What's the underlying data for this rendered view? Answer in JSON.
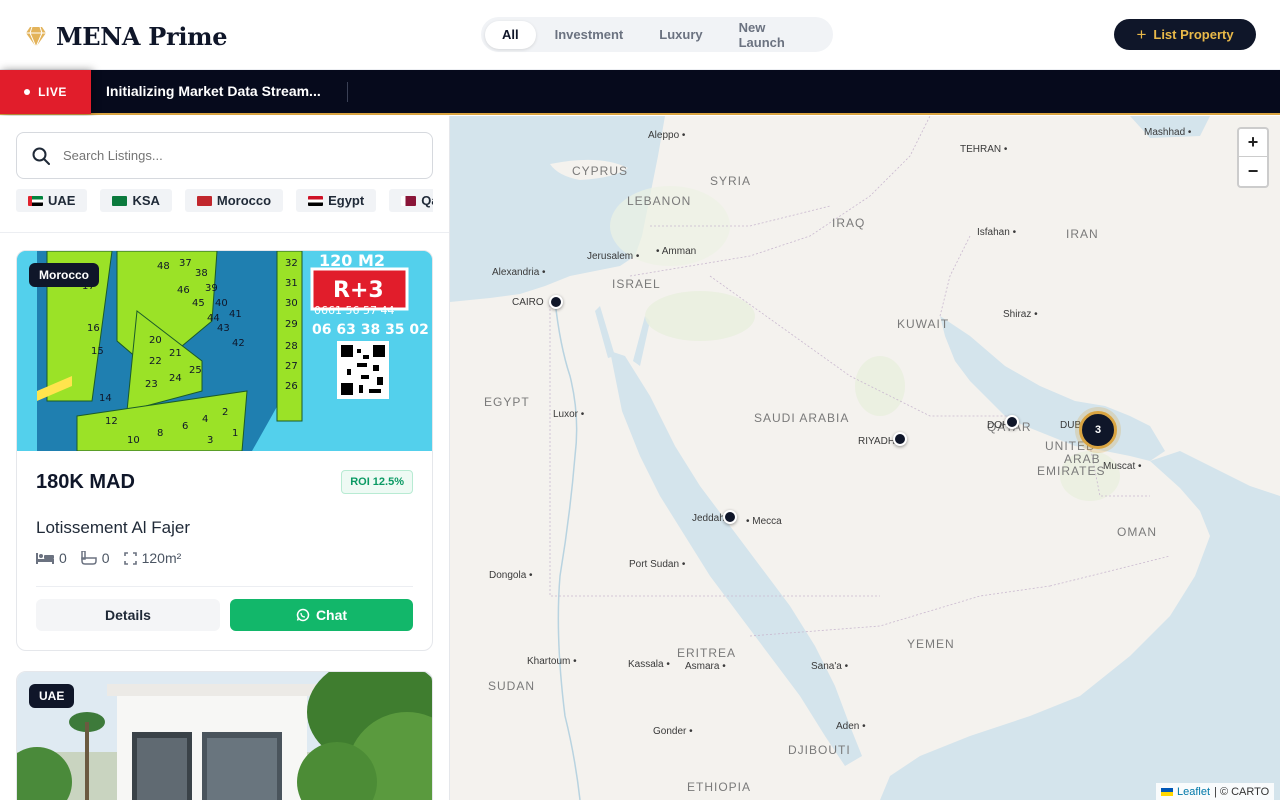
{
  "header": {
    "brand": "MENA Prime",
    "tabs": [
      {
        "label": "All",
        "active": true
      },
      {
        "label": "Investment",
        "active": false
      },
      {
        "label": "Luxury",
        "active": false
      },
      {
        "label": "New Launch",
        "active": false
      }
    ],
    "list_button": "List Property"
  },
  "ticker": {
    "live_label": "LIVE",
    "message": "Initializing Market Data Stream..."
  },
  "sidebar": {
    "search_placeholder": "Search Listings...",
    "countries": [
      "UAE",
      "KSA",
      "Morocco",
      "Egypt",
      "Qatar"
    ],
    "cards": [
      {
        "badge": "Morocco",
        "price": "180K MAD",
        "roi": "ROI 12.5%",
        "title": "Lotissement Al Fajer",
        "beds": "0",
        "baths": "0",
        "area": "120m²",
        "details_label": "Details",
        "chat_label": "Chat",
        "image_text": {
          "size": "120 M2",
          "type": "R+3",
          "phone1": "0661 56 57 44",
          "phone2": "06 63 38 35 02"
        }
      },
      {
        "badge": "UAE"
      }
    ]
  },
  "map": {
    "cities": [
      {
        "name": "Aleppo"
      },
      {
        "name": "Mashhad"
      },
      {
        "name": "TEHRAN"
      },
      {
        "name": "Isfahan"
      },
      {
        "name": "Jerusalem"
      },
      {
        "name": "Amman"
      },
      {
        "name": "Alexandria"
      },
      {
        "name": "CAIRO"
      },
      {
        "name": "Shiraz"
      },
      {
        "name": "Luxor"
      },
      {
        "name": "RIYADH"
      },
      {
        "name": "DOHA"
      },
      {
        "name": "DUBAI"
      },
      {
        "name": "Muscat"
      },
      {
        "name": "Jeddah"
      },
      {
        "name": "Mecca"
      },
      {
        "name": "Port Sudan"
      },
      {
        "name": "Dongola"
      },
      {
        "name": "Khartoum"
      },
      {
        "name": "Kassala"
      },
      {
        "name": "Asmara"
      },
      {
        "name": "Sana'a"
      },
      {
        "name": "Aden"
      },
      {
        "name": "Gonder"
      }
    ],
    "countries": [
      "CYPRUS",
      "SYRIA",
      "LEBANON",
      "IRAQ",
      "IRAN",
      "ISRAEL",
      "KUWAIT",
      "EGYPT",
      "SAUDI ARABIA",
      "QATAR",
      "UNITED",
      "ARAB",
      "EMIRATES",
      "OMAN",
      "YEMEN",
      "ERITREA",
      "SUDAN",
      "DJIBOUTI",
      "ETHIOPIA"
    ],
    "cluster_count": "3",
    "zoom_in": "+",
    "zoom_out": "−",
    "attribution_link": "Leaflet",
    "attribution_text": "| © CARTO"
  }
}
